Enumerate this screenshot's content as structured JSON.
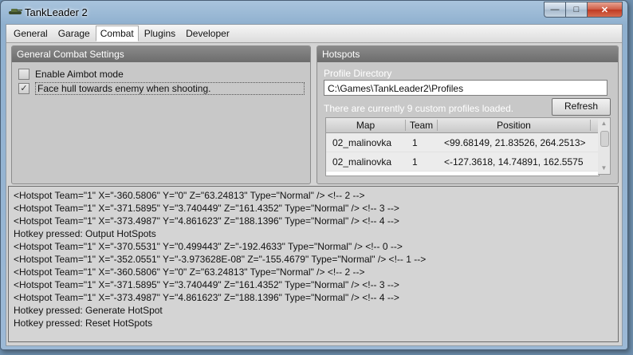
{
  "window": {
    "title": "TankLeader 2",
    "min_label": "—",
    "max_label": "□",
    "close_label": "✕"
  },
  "menu": {
    "tabs": [
      "General",
      "Garage",
      "Combat",
      "Plugins",
      "Developer"
    ],
    "active": "Combat"
  },
  "combat_settings": {
    "header": "General Combat Settings",
    "aimbot_label": "Enable Aimbot mode",
    "aimbot_checked": false,
    "face_hull_label": "Face hull towards enemy when shooting.",
    "face_hull_checked": true,
    "check_glyph": "✓"
  },
  "hotspots": {
    "header": "Hotspots",
    "profile_dir_label": "Profile Directory",
    "profile_dir_value": "C:\\Games\\TankLeader2\\Profiles",
    "status_text": "There are currently 9 custom profiles loaded.",
    "refresh_label": "Refresh",
    "columns": [
      "Map",
      "Team",
      "Position"
    ],
    "rows": [
      [
        "02_malinovka",
        "1",
        "<99.68149, 21.83526, 264.2513>"
      ],
      [
        "02_malinovka",
        "1",
        "<-127.3618, 14.74891, 162.5575"
      ]
    ],
    "scroll_up": "▲",
    "scroll_down": "▼"
  },
  "log": [
    "<Hotspot Team=\"1\" X=\"-360.5806\" Y=\"0\" Z=\"63.24813\" Type=\"Normal\" /> <!-- 2 -->",
    "<Hotspot Team=\"1\" X=\"-371.5895\" Y=\"3.740449\" Z=\"161.4352\" Type=\"Normal\" /> <!-- 3 -->",
    "<Hotspot Team=\"1\" X=\"-373.4987\" Y=\"4.861623\" Z=\"188.1396\" Type=\"Normal\" /> <!-- 4 -->",
    "Hotkey pressed: Output HotSpots",
    "<Hotspot Team=\"1\" X=\"-370.5531\" Y=\"0.499443\" Z=\"-192.4633\" Type=\"Normal\" /> <!-- 0 -->",
    "<Hotspot Team=\"1\" X=\"-352.0551\" Y=\"-3.973628E-08\" Z=\"-155.4679\" Type=\"Normal\" /> <!-- 1 -->",
    "<Hotspot Team=\"1\" X=\"-360.5806\" Y=\"0\" Z=\"63.24813\" Type=\"Normal\" /> <!-- 2 -->",
    "<Hotspot Team=\"1\" X=\"-371.5895\" Y=\"3.740449\" Z=\"161.4352\" Type=\"Normal\" /> <!-- 3 -->",
    "<Hotspot Team=\"1\" X=\"-373.4987\" Y=\"4.861623\" Z=\"188.1396\" Type=\"Normal\" /> <!-- 4 -->",
    "Hotkey pressed: Generate HotSpot",
    "Hotkey pressed: Reset HotSpots"
  ]
}
